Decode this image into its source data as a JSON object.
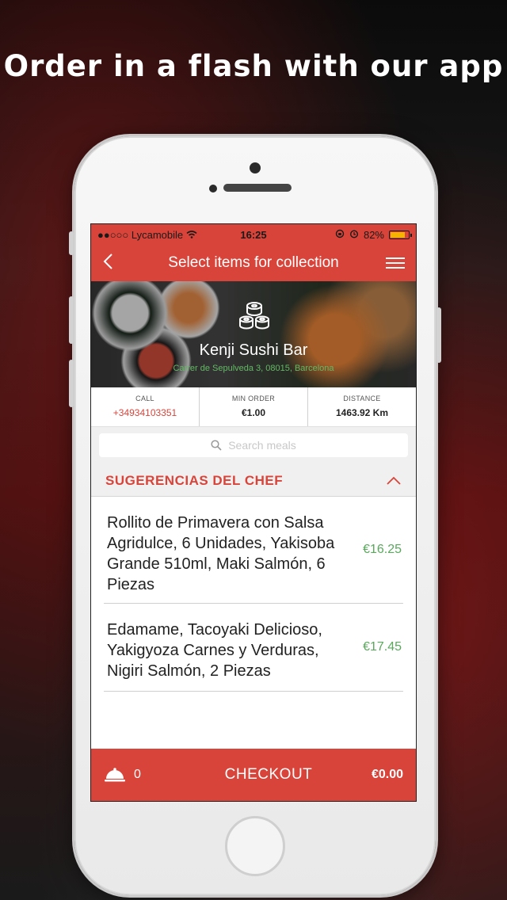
{
  "headline": "Order in a flash with our app",
  "status_bar": {
    "carrier": "●●○○○ Lycamobile",
    "time": "16:25",
    "battery": "82%",
    "battery_level": 0.82
  },
  "nav": {
    "title": "Select items for collection"
  },
  "restaurant": {
    "name": "Kenji Sushi Bar",
    "address": "Carrer de Sepulveda 3, 08015, Barcelona"
  },
  "info": [
    {
      "label": "CALL",
      "value": "+34934103351"
    },
    {
      "label": "MIN ORDER",
      "value": "€1.00"
    },
    {
      "label": "DISTANCE",
      "value": "1463.92 Km"
    }
  ],
  "search": {
    "placeholder": "Search meals"
  },
  "section": {
    "title": "SUGERENCIAS DEL CHEF"
  },
  "items": [
    {
      "name": "Rollito de Primavera con Salsa Agridulce, 6 Unidades, Yakisoba Grande 510ml, Maki Salmón, 6 Piezas",
      "price": "€16.25"
    },
    {
      "name": "Edamame, Tacoyaki Delicioso, Yakigyoza Carnes y Verduras, Nigiri Salmón, 2 Piezas",
      "price": "€17.45"
    }
  ],
  "checkout": {
    "count": "0",
    "label": "CHECKOUT",
    "total": "€0.00"
  },
  "colors": {
    "accent": "#d9443a",
    "price": "#5aa85c"
  }
}
